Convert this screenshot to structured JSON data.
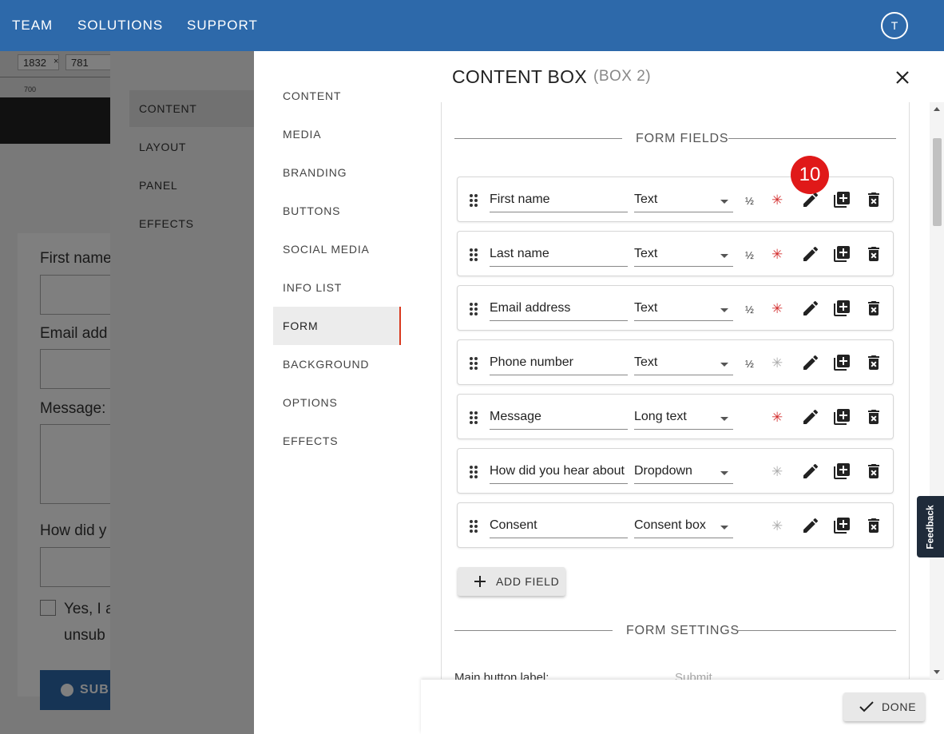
{
  "topnav": {
    "items": [
      "TEAM",
      "SOLUTIONS",
      "SUPPORT"
    ],
    "avatar": "T"
  },
  "background": {
    "width_value": "1832",
    "times": "×",
    "height_value": "781",
    "ruler_tick": "700",
    "form_labels": [
      "First name",
      "Email add",
      "Message:",
      "How did y"
    ],
    "consent_text": [
      "Yes, I a",
      "unsub"
    ],
    "submit": "SUB"
  },
  "sidebar2": {
    "items": [
      "CONTENT",
      "LAYOUT",
      "PANEL",
      "EFFECTS"
    ],
    "active": "CONTENT"
  },
  "modal": {
    "title": "CONTENT BOX",
    "subtitle": "(BOX 2)",
    "nav": [
      "CONTENT",
      "MEDIA",
      "BRANDING",
      "BUTTONS",
      "SOCIAL MEDIA",
      "INFO LIST",
      "FORM",
      "BACKGROUND",
      "OPTIONS",
      "EFFECTS"
    ],
    "nav_active": "FORM",
    "section_form_fields": "FORM FIELDS",
    "badge": "10",
    "fields": [
      {
        "name": "First name",
        "type": "Text",
        "half": "½",
        "required": true
      },
      {
        "name": "Last name",
        "type": "Text",
        "half": "½",
        "required": true
      },
      {
        "name": "Email address",
        "type": "Text",
        "half": "½",
        "required": true
      },
      {
        "name": "Phone number",
        "type": "Text",
        "half": "½",
        "required": false
      },
      {
        "name": "Message",
        "type": "Long text",
        "half": "",
        "required": true
      },
      {
        "name": "How did you hear about",
        "type": "Dropdown",
        "half": "",
        "required": false
      },
      {
        "name": "Consent",
        "type": "Consent box",
        "half": "",
        "required": false
      }
    ],
    "add_field": "ADD FIELD",
    "section_form_settings": "FORM SETTINGS",
    "main_button_label": "Main button label:",
    "main_button_value": "Submit",
    "done": "DONE"
  },
  "feedback": "Feedback",
  "colors": {
    "brand": "#2d69aa",
    "required": "#d32f2f",
    "badge": "#e01919",
    "active_border": "#d9391f"
  }
}
